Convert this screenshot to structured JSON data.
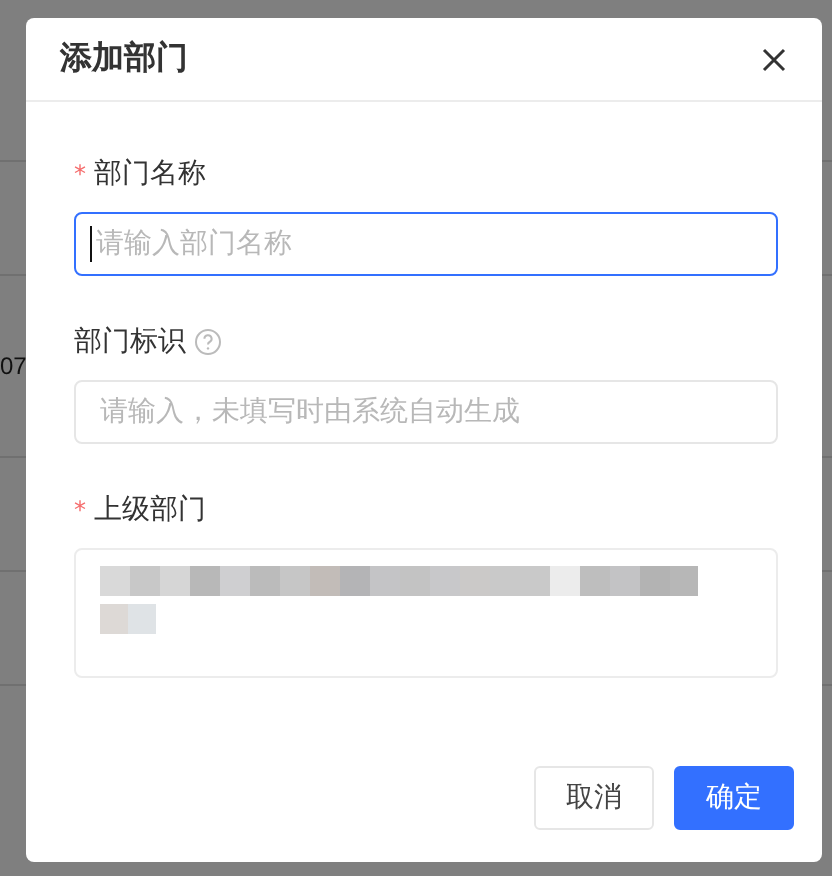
{
  "background": {
    "cell_text": "07"
  },
  "dialog": {
    "title": "添加部门",
    "fields": [
      {
        "kind": "input",
        "required_mark": "*",
        "label": "部门名称",
        "help": false,
        "placeholder": "请输入部门名称",
        "focused": true
      },
      {
        "kind": "input",
        "label": "部门标识",
        "help": true,
        "placeholder": "请输入，未填写时由系统自动生成",
        "focused": false
      },
      {
        "kind": "redacted",
        "required_mark": "*",
        "label": "上级部门",
        "help": false
      }
    ],
    "buttons": [
      {
        "label": "取消",
        "primary": false
      },
      {
        "label": "确定",
        "primary": true
      }
    ]
  }
}
